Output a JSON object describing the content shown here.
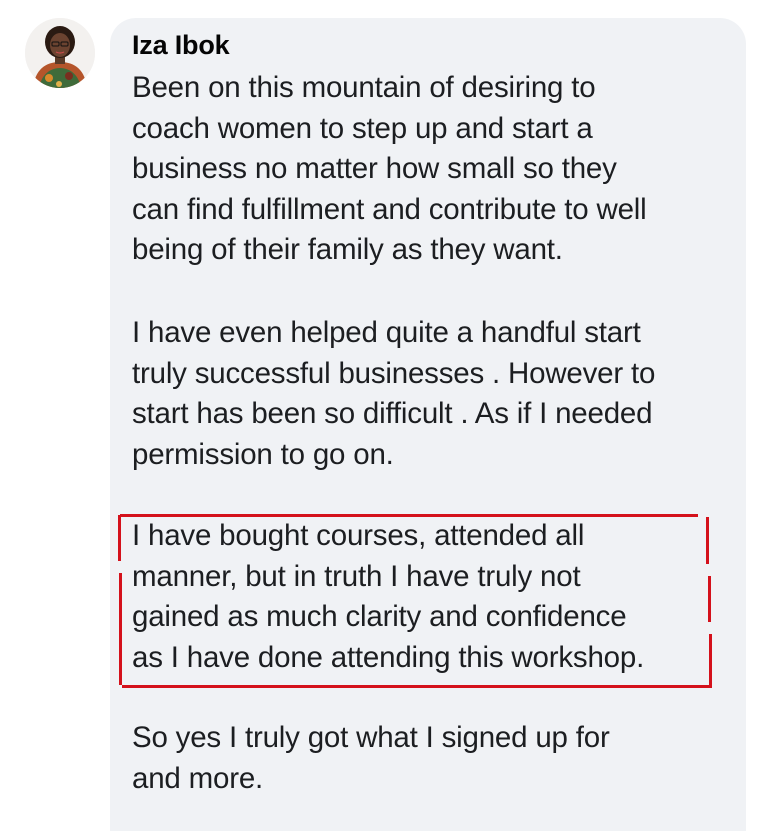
{
  "comment": {
    "author": "Iza Ibok",
    "paragraphs": [
      "Been on this mountain of desiring to\ncoach women to step up and start a\nbusiness no matter how small so they\ncan find fulfillment and contribute to well\nbeing of their family as they want.",
      "I have even helped quite a handful start\ntruly successful businesses . However to\nstart has been so difficult . As if I needed\npermission to go on.",
      "I have bought courses, attended all\nmanner, but in truth I have truly not\ngained as much clarity and confidence\nas I have done attending this workshop.",
      "So yes I truly got what I signed up for\nand more."
    ],
    "highlight_color": "#d4111b"
  }
}
